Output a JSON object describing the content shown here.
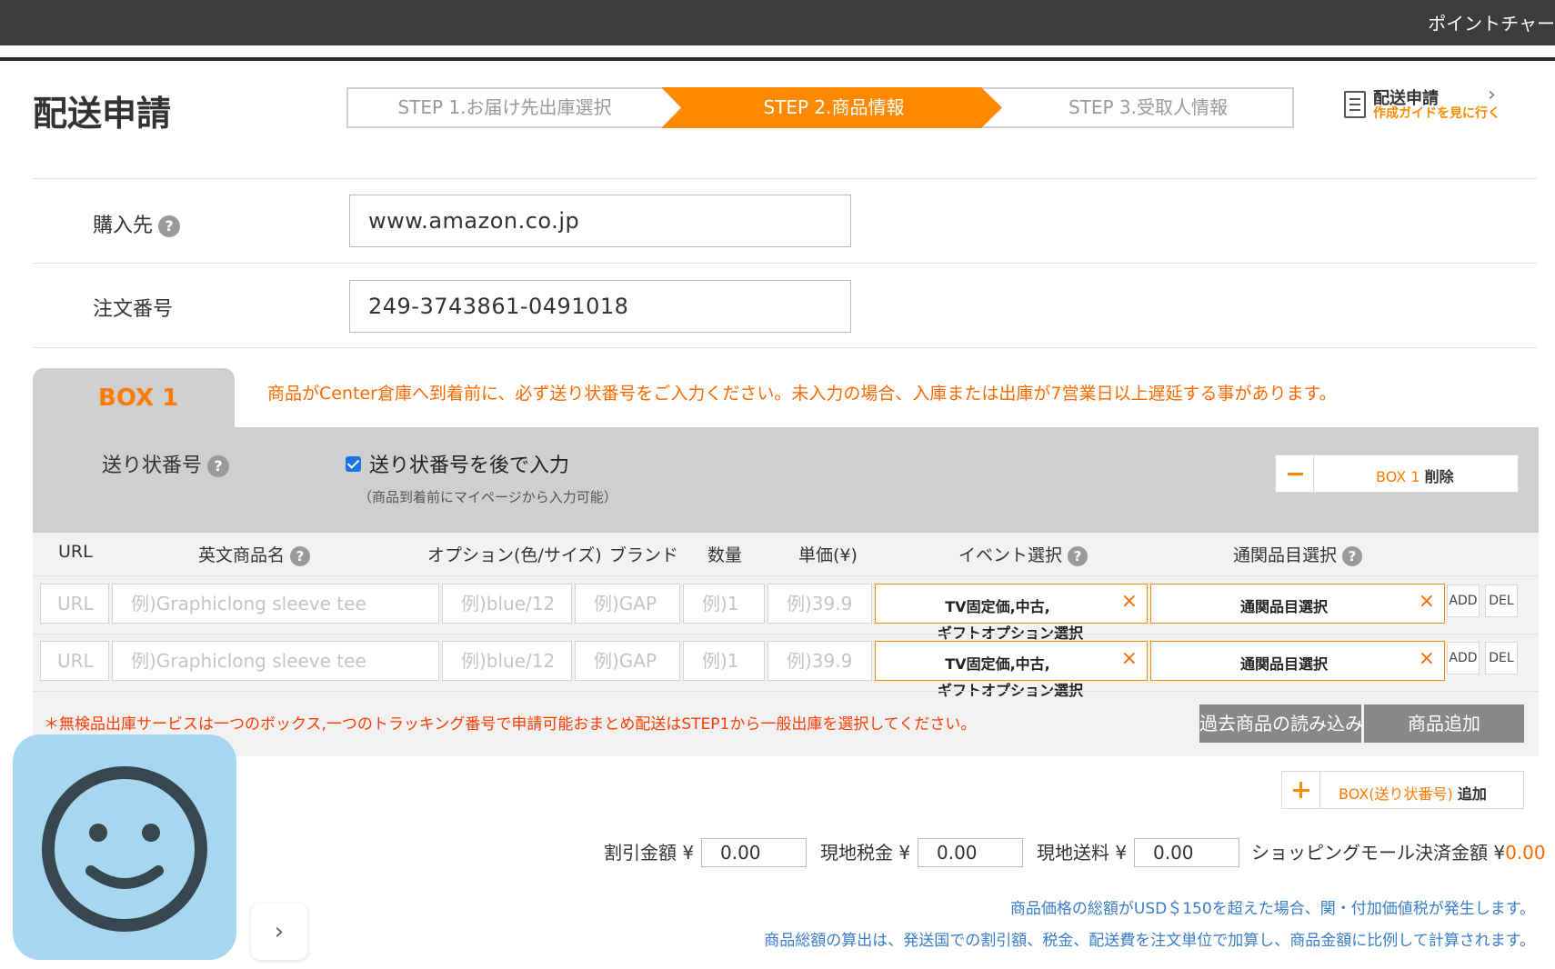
{
  "topbar": {
    "points_label": "ポイントチャー"
  },
  "page_title": "配送申請",
  "steps": [
    {
      "label": "STEP 1.お届け先出庫選択"
    },
    {
      "label": "STEP 2.商品情報"
    },
    {
      "label": "STEP 3.受取人情報"
    }
  ],
  "guide": {
    "line1": "配送申請",
    "line2": "作成ガイドを見に行く"
  },
  "form": {
    "purchase_label": "購入先",
    "purchase_value": "www.amazon.co.jp",
    "order_label": "注文番号",
    "order_value": "249-3743861-0491018",
    "help_glyph": "?"
  },
  "box": {
    "tab_label": "BOX 1",
    "warning": "商品がCenter倉庫へ到着前に、必ず送り状番号をご入力ください。未入力の場合、入庫または出庫が7営業日以上遅延する事があります。",
    "tracking_label": "送り状番号",
    "later_label": "送り状番号を後で入力",
    "later_checked": true,
    "later_note": "（商品到着前にマイページから入力可能）",
    "delete_box": "BOX 1",
    "delete_label": "削除"
  },
  "table": {
    "headers": {
      "url": "URL",
      "name": "英文商品名",
      "option": "オプション(色/サイズ)",
      "brand": "ブランド",
      "qty": "数量",
      "price": "単価(¥)",
      "event": "イベント選択",
      "customs": "通関品目選択"
    },
    "placeholders": {
      "url": "URL",
      "name": "例)Graphiclong sleeve tee",
      "option": "例)blue/12",
      "brand": "例)GAP",
      "qty": "例)1",
      "price": "例)39.9"
    },
    "rows": [
      {
        "event_line1": "TV固定価,中古,",
        "event_line2": "ギフトオプション選択",
        "customs": "通関品目選択",
        "add": "ADD",
        "del": "DEL"
      },
      {
        "event_line1": "TV固定価,中古,",
        "event_line2": "ギフトオプション選択",
        "customs": "通関品目選択",
        "add": "ADD",
        "del": "DEL"
      }
    ],
    "remove_glyph": "×",
    "footnote": "＊無検品出庫サービスは一つのボックス,一つのトラッキング番号で申請可能おまとめ配送はSTEP1から一般出庫を選択してください。",
    "load_past": "過去商品の読み込み",
    "add_item": "商品追加"
  },
  "add_box": {
    "part1": "BOX(送り状番号)",
    "part2": "追加"
  },
  "totals": {
    "discount_label": "割引金額 ¥",
    "discount_value": "0.00",
    "tax_label": "現地税金 ¥",
    "tax_value": "0.00",
    "shipping_label": "現地送料 ¥",
    "shipping_value": "0.00",
    "mall_label": "ショッピングモール決済金額 ¥",
    "mall_value": "0.00"
  },
  "notes": {
    "line1": "商品価格の総額がUSD＄150を超えた場合、関・付加価値税が発生します。",
    "line2": "商品総額の算出は、発送国での割引額、税金、配送費を注文単位で加算し、商品金額に比例して計算されます。"
  },
  "widget": {
    "next_glyph": "›"
  },
  "colors": {
    "accent": "#ff8a00",
    "warning": "#ff6a00",
    "note_blue": "#3a7dc9",
    "widget_bg": "#a7d7ef"
  }
}
